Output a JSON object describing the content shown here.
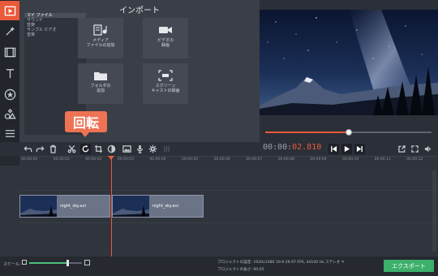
{
  "left_tools": [
    "media-import-icon",
    "magic-wand-icon",
    "filmstrip-icon",
    "titles-icon",
    "star-icon",
    "shapes-icon",
    "menu-icon"
  ],
  "import": {
    "title": "インポート",
    "files": [
      "マイ ファイル",
      "サウンド",
      "音楽",
      "サンプル ビデオ",
      "音楽"
    ],
    "tiles": [
      {
        "label_line1": "メディア",
        "label_line2": "ファイルの追加",
        "icon": "media-files-icon"
      },
      {
        "label_line1": "ビデオの",
        "label_line2": "録画",
        "icon": "camera-icon"
      },
      {
        "label_line1": "フォルダの",
        "label_line2": "追加",
        "icon": "folder-icon"
      },
      {
        "label_line1": "スクリーン",
        "label_line2": "キャストの録画",
        "icon": "screencast-icon"
      }
    ]
  },
  "callout": {
    "label": "回転"
  },
  "preview": {
    "progress": 0.5,
    "time_static": "00:00:",
    "time_highlight": "02.810"
  },
  "timeline": {
    "ticks": [
      "00:00:00",
      "00:00:01",
      "00:00:02",
      "00:00:03",
      "00:00:04",
      "00:00:05",
      "00:00:06",
      "00:00:07",
      "00:00:08",
      "00:00:09",
      "00:00:10",
      "00:00:11",
      "00:00:12"
    ],
    "clips": [
      {
        "name": "night_sky.avi"
      },
      {
        "name": "night_sky.avi"
      }
    ]
  },
  "footer": {
    "scale_label": "スケール:",
    "zoom": 0.72,
    "settings_label": "プロジェクトの設定:",
    "settings_value": "1920x1080 16:9 29.97 FPS, 44100 Hz ステレオ",
    "length_label": "プロジェクトの長さ:",
    "length_value": "00:05",
    "export_label": "エクスポート"
  },
  "colors": {
    "accent": "#e95a3a",
    "export": "#3db06b",
    "callout": "#ee7354"
  }
}
